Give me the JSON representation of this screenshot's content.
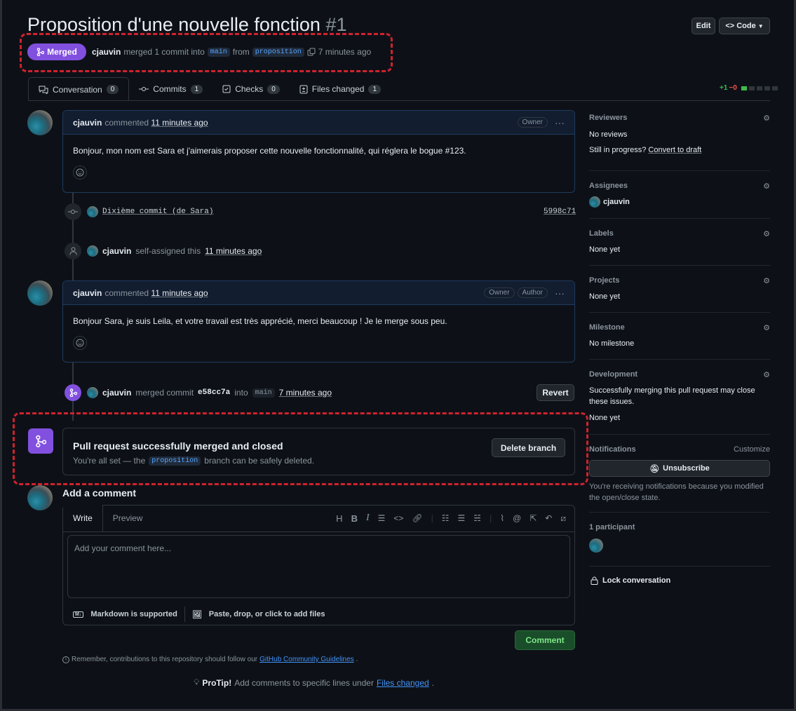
{
  "header": {
    "title": "Proposition d'une nouvelle fonction",
    "number": "#1",
    "edit_label": "Edit",
    "code_label": "Code",
    "status": "Merged",
    "author": "cjauvin",
    "merge_text": "merged 1 commit into",
    "base_branch": "main",
    "from_text": "from",
    "head_branch": "proposition",
    "time": "7 minutes ago"
  },
  "tabs": [
    {
      "label": "Conversation",
      "count": "0"
    },
    {
      "label": "Commits",
      "count": "1"
    },
    {
      "label": "Checks",
      "count": "0"
    },
    {
      "label": "Files changed",
      "count": "1"
    }
  ],
  "diffstat": {
    "additions": "+1",
    "deletions": "−0"
  },
  "comment1": {
    "author": "cjauvin",
    "action": "commented",
    "time": "11 minutes ago",
    "badge": "Owner",
    "body": "Bonjour, mon nom est Sara et j'aimerais proposer cette nouvelle fonctionnalité, qui réglera le bogue #123."
  },
  "commit_event": {
    "message": "Dixième commit (de Sara)",
    "sha": "5998c71"
  },
  "assign_event": {
    "user": "cjauvin",
    "text": "self-assigned this",
    "time": "11 minutes ago"
  },
  "comment2": {
    "author": "cjauvin",
    "action": "commented",
    "time": "11 minutes ago",
    "badge1": "Owner",
    "badge2": "Author",
    "body": "Bonjour Sara, je suis Leila, et votre travail est très apprécié, merci beaucoup ! Je le merge sous peu."
  },
  "merge_event": {
    "user": "cjauvin",
    "text": "merged commit",
    "sha": "e58cc7a",
    "into": "into",
    "branch": "main",
    "time": "7 minutes ago",
    "revert_label": "Revert"
  },
  "merged_box": {
    "title": "Pull request successfully merged and closed",
    "text_before": "You're all set — the",
    "branch": "proposition",
    "text_after": "branch can be safely deleted.",
    "delete_label": "Delete branch"
  },
  "add_comment": {
    "heading": "Add a comment",
    "write_tab": "Write",
    "preview_tab": "Preview",
    "placeholder": "Add your comment here...",
    "markdown_note": "Markdown is supported",
    "attach_note": "Paste, drop, or click to add files",
    "submit_label": "Comment"
  },
  "footer": {
    "guidelines_text": "Remember, contributions to this repository should follow our",
    "guidelines_link": "GitHub Community Guidelines",
    "protip_label": "ProTip!",
    "protip_text": "Add comments to specific lines under",
    "protip_link": "Files changed"
  },
  "sidebar": {
    "reviewers": {
      "title": "Reviewers",
      "value": "No reviews",
      "progress": "Still in progress?",
      "draft_link": "Convert to draft"
    },
    "assignees": {
      "title": "Assignees",
      "value": "cjauvin"
    },
    "labels": {
      "title": "Labels",
      "value": "None yet"
    },
    "projects": {
      "title": "Projects",
      "value": "None yet"
    },
    "milestone": {
      "title": "Milestone",
      "value": "No milestone"
    },
    "development": {
      "title": "Development",
      "text": "Successfully merging this pull request may close these issues.",
      "value": "None yet"
    },
    "notifications": {
      "title": "Notifications",
      "customize": "Customize",
      "unsubscribe": "Unsubscribe",
      "reason": "You're receiving notifications because you modified the open/close state."
    },
    "participants": {
      "title": "1 participant"
    },
    "lock": "Lock conversation"
  },
  "colors": {
    "merged_purple": "#8250df",
    "annotation_red": "#d0222e",
    "comment_green": "#238636"
  }
}
